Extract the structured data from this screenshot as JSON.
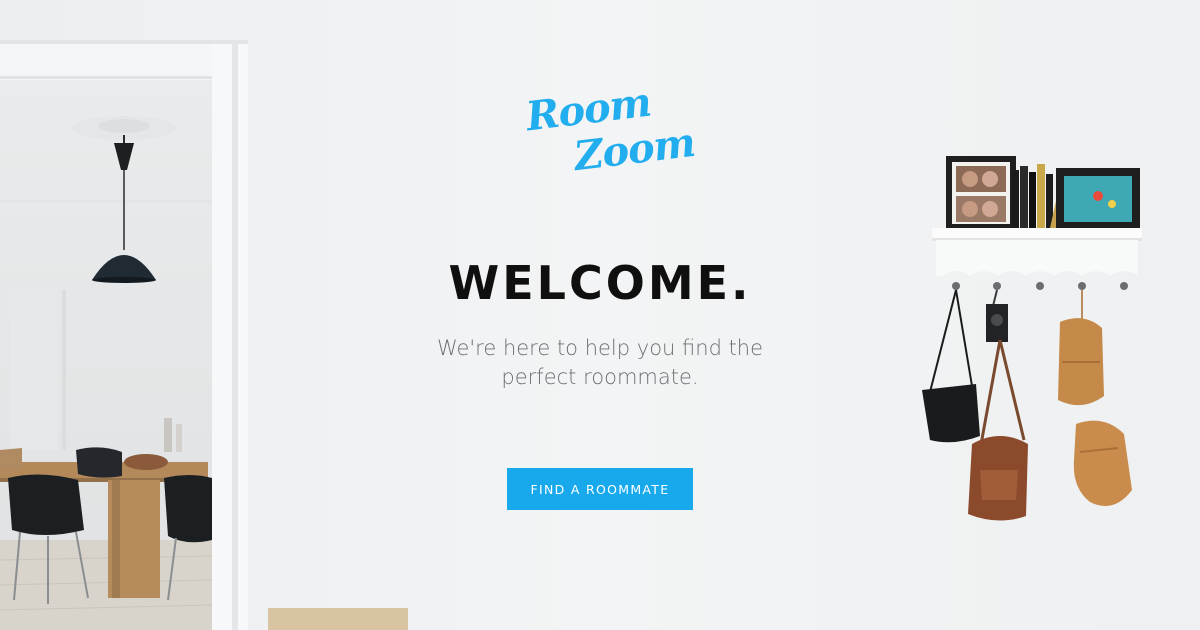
{
  "logo": {
    "line1": "Room",
    "line2": "Zoom",
    "color": "#22aeee"
  },
  "hero": {
    "title": "WELCOME.",
    "tagline": "We're here to help you find the perfect roommate.",
    "cta_label": "FIND A ROOMMATE",
    "cta_color": "#17a9ec"
  }
}
